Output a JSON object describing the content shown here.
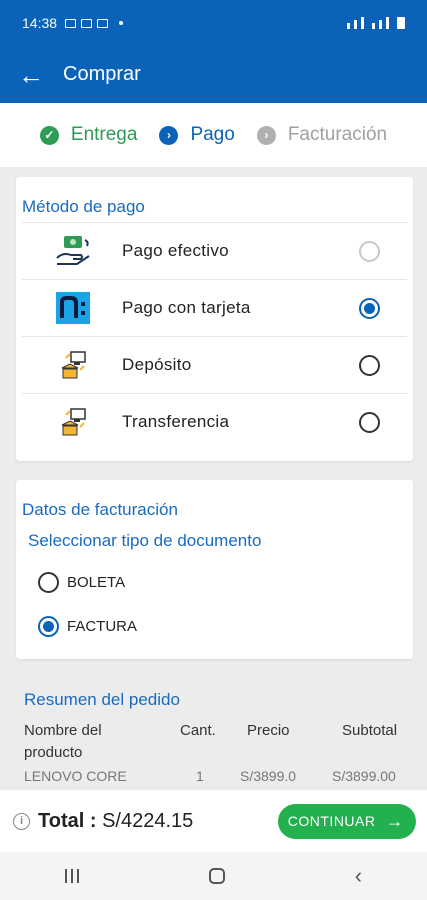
{
  "status": {
    "time": "14:38"
  },
  "appbar": {
    "back_icon": "arrow-left-icon",
    "title": "Comprar"
  },
  "steps": [
    {
      "label": "Entrega",
      "state": "done"
    },
    {
      "label": "Pago",
      "state": "active"
    },
    {
      "label": "Facturación",
      "state": "pending"
    }
  ],
  "payment": {
    "title": "Método de pago",
    "options": [
      {
        "label": "Pago efectivo",
        "icon": "cash-hands-icon",
        "state": "disabled"
      },
      {
        "label": "Pago con tarjeta",
        "icon": "niubiz-card-icon",
        "state": "checked"
      },
      {
        "label": "Depósito",
        "icon": "bank-transfer-icon",
        "state": "unchecked"
      },
      {
        "label": "Transferencia",
        "icon": "bank-transfer-icon",
        "state": "unchecked"
      }
    ]
  },
  "billing": {
    "title": "Datos de facturación",
    "subtitle": "Seleccionar tipo de documento",
    "options": [
      {
        "label": "BOLETA",
        "state": "unchecked"
      },
      {
        "label": "FACTURA",
        "state": "checked"
      }
    ]
  },
  "summary": {
    "title": "Resumen del pedido",
    "headers": {
      "name": "Nombre del producto",
      "qty": "Cant.",
      "price": "Precio",
      "subtotal": "Subtotal"
    },
    "rows": [
      {
        "name": "LENOVO CORE",
        "qty": "1",
        "price": "S/3899.0",
        "subtotal": "S/3899.00"
      }
    ]
  },
  "footer": {
    "total_label": "Total :",
    "total_value": "S/4224.15",
    "continue_label": "CONTINUAR"
  },
  "colors": {
    "primary": "#0a63b8",
    "success": "#2e9c57",
    "button": "#23b04e"
  }
}
